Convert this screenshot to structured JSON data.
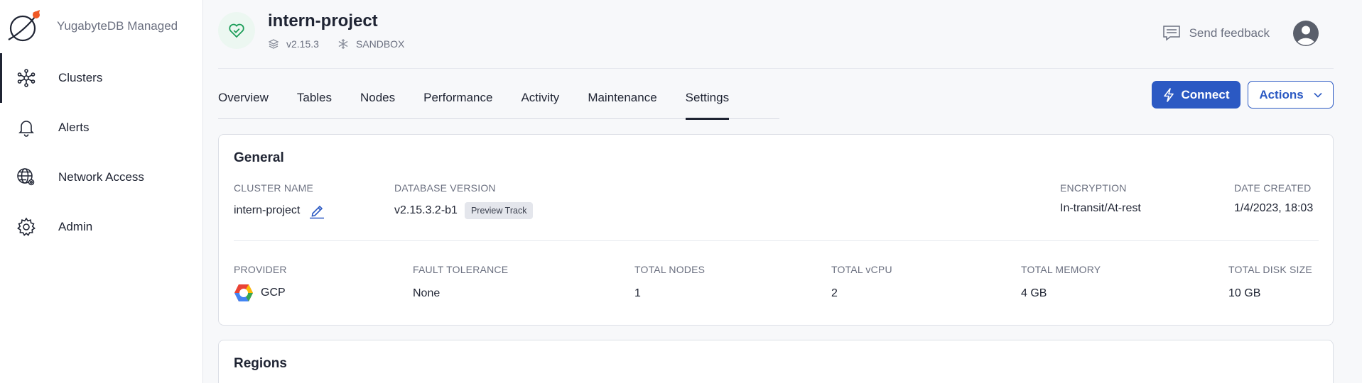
{
  "brand": {
    "name": "YugabyteDB Managed",
    "accent": "#ef5824"
  },
  "nav": {
    "items": [
      {
        "label": "Clusters",
        "icon": "clusters-icon",
        "active": true
      },
      {
        "label": "Alerts",
        "icon": "bell-icon"
      },
      {
        "label": "Network Access",
        "icon": "globe-settings-icon"
      },
      {
        "label": "Admin",
        "icon": "gear-icon"
      }
    ]
  },
  "header": {
    "cluster_name": "intern-project",
    "version": "v2.15.3",
    "tier": "SANDBOX",
    "feedback_label": "Send feedback"
  },
  "tabs": [
    "Overview",
    "Tables",
    "Nodes",
    "Performance",
    "Activity",
    "Maintenance",
    "Settings"
  ],
  "active_tab": "Settings",
  "buttons": {
    "connect": "Connect",
    "actions": "Actions"
  },
  "general": {
    "title": "General",
    "cluster_name_label": "CLUSTER NAME",
    "cluster_name_value": "intern-project",
    "db_version_label": "DATABASE VERSION",
    "db_version_value": "v2.15.3.2-b1",
    "track_badge": "Preview Track",
    "encryption_label": "ENCRYPTION",
    "encryption_value": "In-transit/At-rest",
    "date_created_label": "DATE CREATED",
    "date_created_value": "1/4/2023, 18:03",
    "provider_label": "PROVIDER",
    "provider_value": "GCP",
    "fault_tolerance_label": "FAULT TOLERANCE",
    "fault_tolerance_value": "None",
    "total_nodes_label": "TOTAL NODES",
    "total_nodes_value": "1",
    "total_vcpu_label": "TOTAL vCPU",
    "total_vcpu_value": "2",
    "total_memory_label": "TOTAL MEMORY",
    "total_memory_value": "4 GB",
    "total_disk_label": "TOTAL DISK SIZE",
    "total_disk_value": "10 GB"
  },
  "regions": {
    "title": "Regions"
  },
  "colors": {
    "primary": "#2b59c3",
    "health_green": "#1e9e5a",
    "text": "#1f2433",
    "muted": "#6b7080"
  }
}
